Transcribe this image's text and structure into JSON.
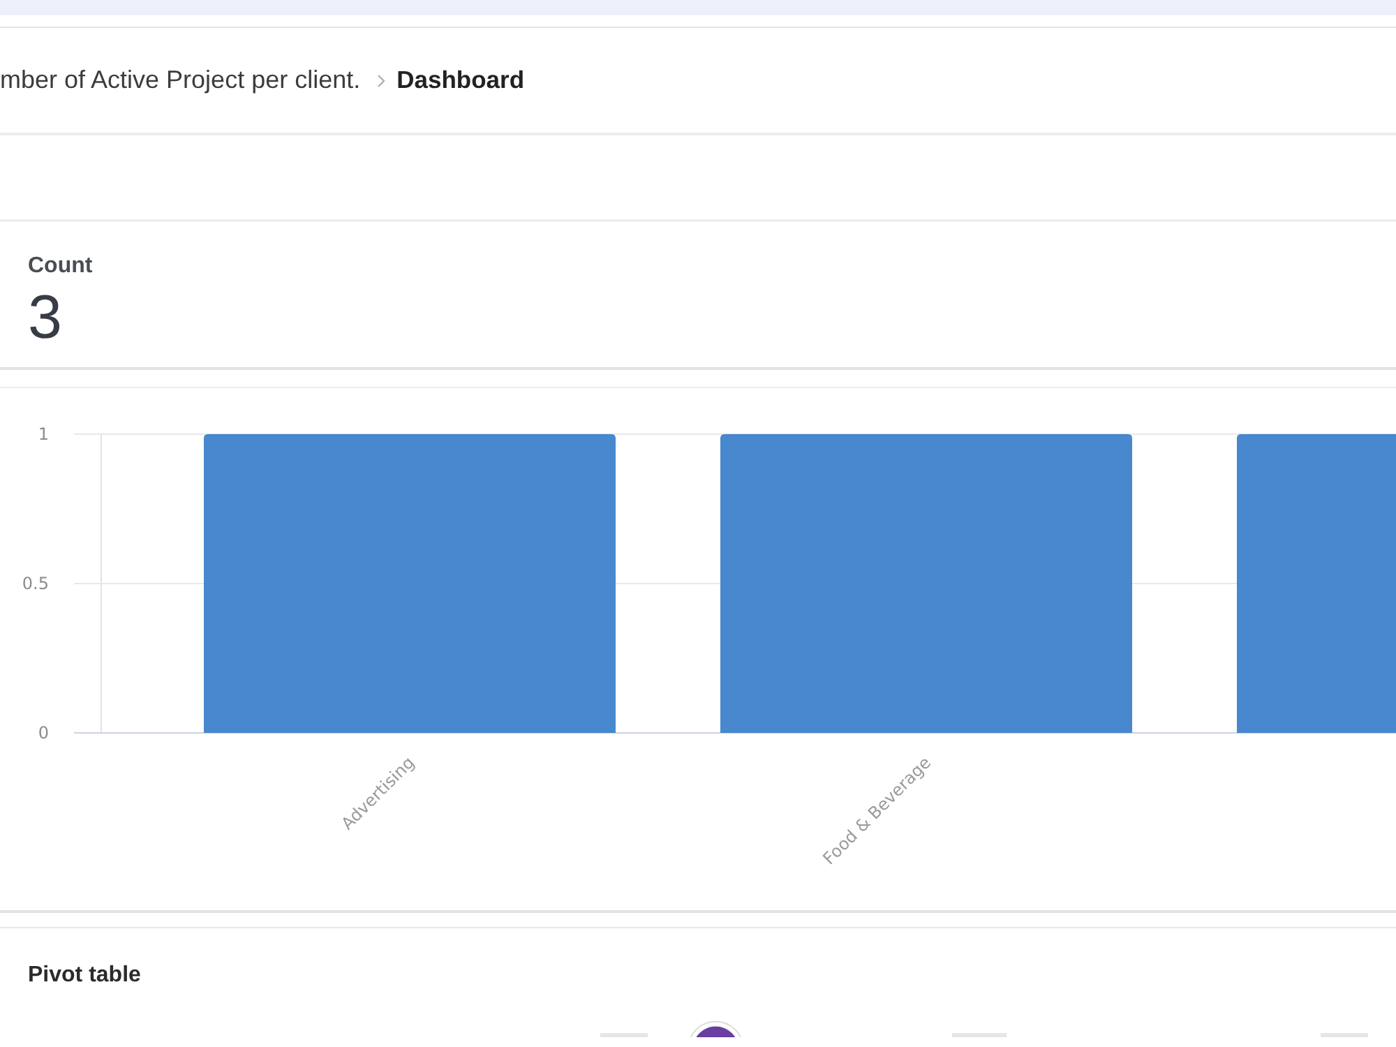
{
  "breadcrumb": [
    {
      "label": "mber of Active Project per client.",
      "current": false
    },
    {
      "label": "Dashboard",
      "current": true
    }
  ],
  "count_card": {
    "label": "Count",
    "value": "3"
  },
  "chart_card": {
    "chart_data": {
      "type": "bar",
      "categories": [
        "Advertising",
        "Food & Beverage",
        null
      ],
      "values": [
        1,
        1,
        1
      ],
      "ylim": [
        0,
        1
      ],
      "yticks": [
        0,
        0.5,
        1
      ]
    }
  },
  "pivot_card": {
    "title": "Pivot table"
  }
}
